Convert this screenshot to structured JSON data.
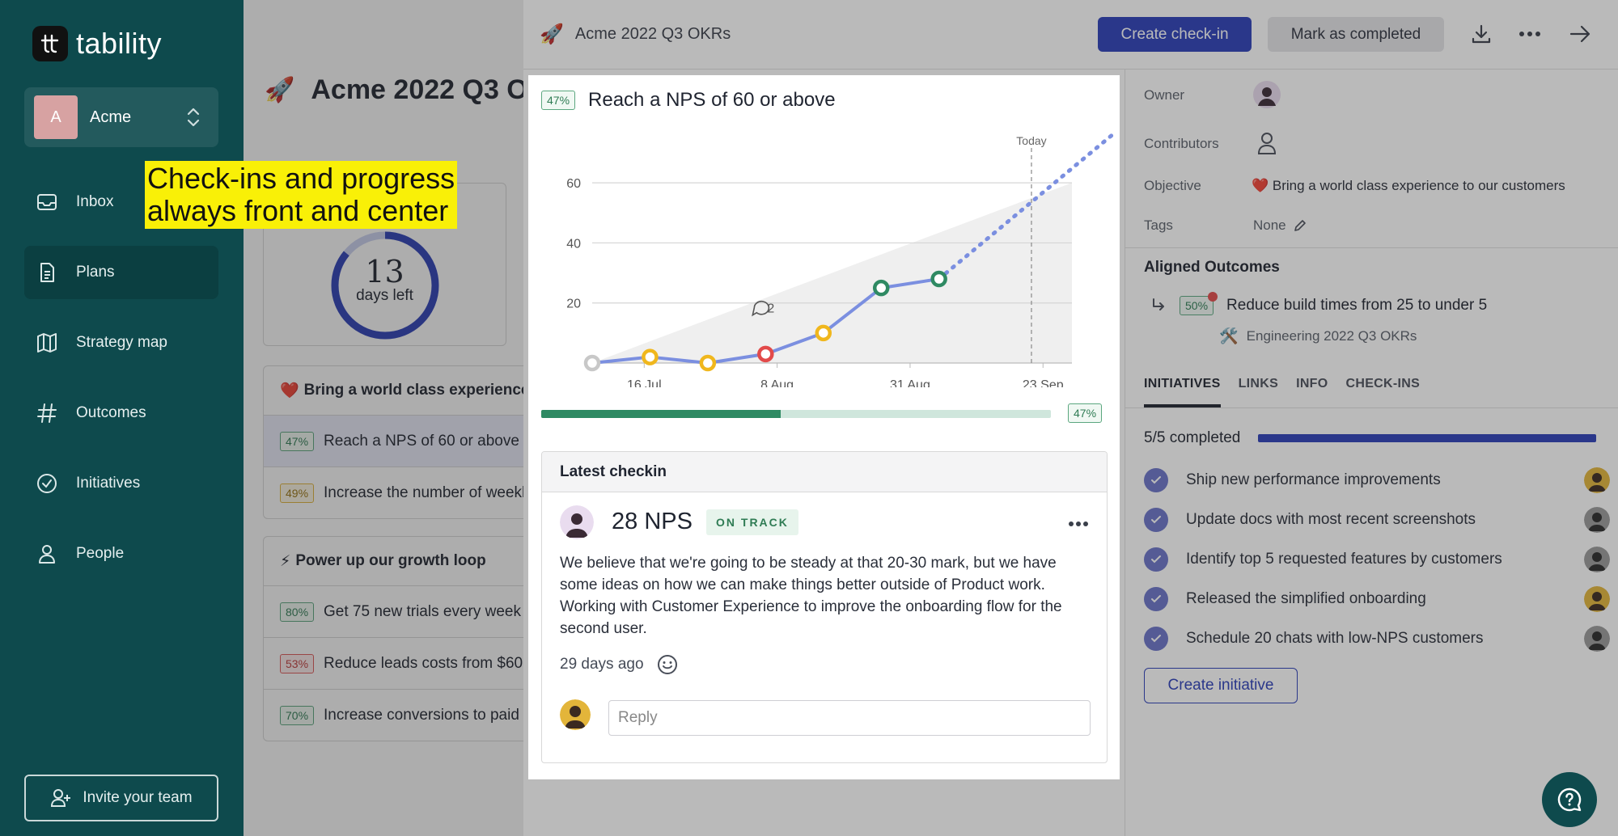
{
  "app": {
    "name": "tability"
  },
  "workspace": {
    "initial": "A",
    "name": "Acme"
  },
  "nav": [
    {
      "label": "Inbox",
      "icon": "inbox-icon"
    },
    {
      "label": "Plans",
      "icon": "document-icon"
    },
    {
      "label": "Strategy map",
      "icon": "map-icon"
    },
    {
      "label": "Outcomes",
      "icon": "hash-icon"
    },
    {
      "label": "Initiatives",
      "icon": "check-circle-icon"
    },
    {
      "label": "People",
      "icon": "person-icon"
    }
  ],
  "invite_label": "Invite your team",
  "callout": {
    "line1": "Check-ins and progress",
    "line2": "always front and center"
  },
  "plan": {
    "title": "Acme 2022 Q3 OKRs",
    "days": {
      "number": "13",
      "label": "days left",
      "fraction_remaining": 0.86
    },
    "objectives": [
      {
        "emoji": "❤️",
        "title": "Bring a world class experience to our customers",
        "krs": [
          {
            "pct": "47%",
            "status": "green",
            "title": "Reach a NPS of 60 or above"
          },
          {
            "pct": "49%",
            "status": "yellow",
            "title": "Increase the number of weekly active users"
          }
        ]
      },
      {
        "emoji": "⚡",
        "title": "Power up our growth loop",
        "krs": [
          {
            "pct": "80%",
            "status": "green",
            "title": "Get 75 new trials every week"
          },
          {
            "pct": "53%",
            "status": "red",
            "title": "Reduce leads costs from $60"
          },
          {
            "pct": "70%",
            "status": "green",
            "title": "Increase conversions to paid"
          }
        ]
      }
    ]
  },
  "drawer": {
    "plan_title": "Acme 2022 Q3 OKRs",
    "create_checkin": "Create check-in",
    "mark_completed": "Mark as completed",
    "kr": {
      "pct": "47%",
      "title": "Reach a NPS of 60 or above",
      "progress": 0.47
    },
    "latest": {
      "header": "Latest checkin",
      "score": "28 NPS",
      "status": "ON TRACK",
      "body": "We believe that we're going to be steady at that 20-30 mark, but we have some ideas on how we can make things better outside of Product work. Working with Customer Experience to improve the onboarding flow for the second user.",
      "time": "29 days ago",
      "reply_placeholder": "Reply"
    },
    "meta": {
      "owner_label": "Owner",
      "contributors_label": "Contributors",
      "objective_label": "Objective",
      "objective_value": "❤️ Bring a world class experience to our customers",
      "tags_label": "Tags",
      "tags_value": "None"
    },
    "aligned": {
      "title": "Aligned Outcomes",
      "pct": "50%",
      "item": "Reduce build times from 25 to under 5",
      "plan": "Engineering 2022 Q3 OKRs"
    },
    "tabs": [
      "INITIATIVES",
      "LINKS",
      "INFO",
      "CHECK-INS"
    ],
    "completed_label": "5/5 completed",
    "completed_fraction": 1.0,
    "initiatives": [
      "Ship new performance improvements",
      "Update docs with most recent screenshots",
      "Identify top 5 requested features by customers",
      "Released the simplified onboarding",
      "Schedule 20 chats with low-NPS customers"
    ],
    "create_initiative": "Create initiative"
  },
  "chart_data": {
    "type": "line",
    "x_ticks": [
      "16 Jul",
      "8 Aug",
      "31 Aug",
      "23 Sep"
    ],
    "y_ticks": [
      20,
      40,
      60
    ],
    "ylim": [
      0,
      70
    ],
    "today_label": "Today",
    "comment_count": "2",
    "actual": [
      {
        "x": "2022-07-07",
        "y": 0,
        "status": "none"
      },
      {
        "x": "2022-07-17",
        "y": 2,
        "status": "at-risk"
      },
      {
        "x": "2022-07-27",
        "y": 0,
        "status": "at-risk"
      },
      {
        "x": "2022-08-06",
        "y": 3,
        "status": "off-track"
      },
      {
        "x": "2022-08-16",
        "y": 10,
        "status": "at-risk"
      },
      {
        "x": "2022-08-26",
        "y": 25,
        "status": "on-track"
      },
      {
        "x": "2022-09-05",
        "y": 28,
        "status": "on-track"
      }
    ],
    "forecast": [
      {
        "x": "2022-09-05",
        "y": 28
      },
      {
        "x": "2022-10-05",
        "y": 76
      }
    ],
    "target_area": [
      {
        "x": "2022-07-07",
        "y": 0
      },
      {
        "x": "2022-09-28",
        "y": 60
      }
    ],
    "today": "2022-09-21",
    "colors": {
      "line": "#7b8fe0",
      "on-track": "#2f8a63",
      "at-risk": "#f0b71d",
      "off-track": "#e24a4a",
      "none": "#c8c8c8"
    }
  }
}
